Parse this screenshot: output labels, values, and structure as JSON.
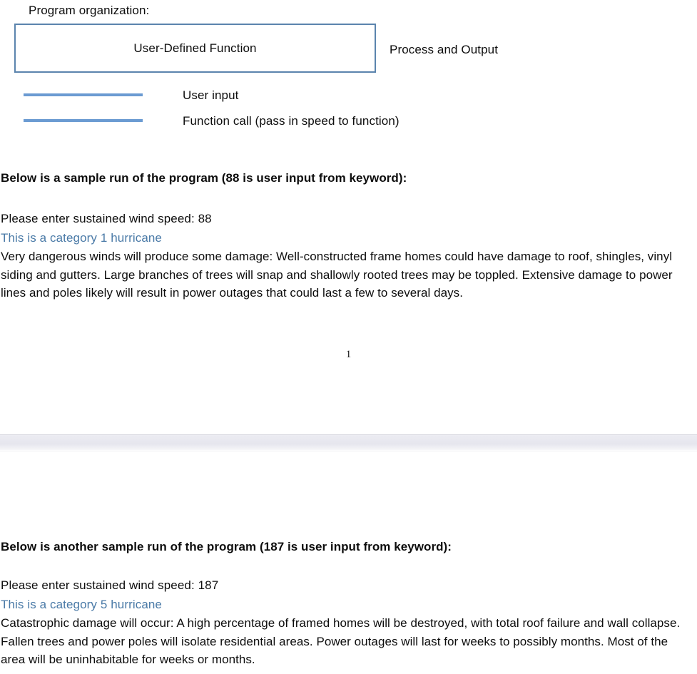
{
  "document": {
    "page_number": "1"
  },
  "diagram": {
    "caption": "Program organization:",
    "function_box_label": "User-Defined Function",
    "process_output_label": "Process and Output",
    "box_border_color": "#5b84ad",
    "legend_line_color": "#6b9bd2",
    "legend": [
      {
        "label": "User input"
      },
      {
        "label": "Function call (pass in speed to function)"
      }
    ]
  },
  "sample_runs": [
    {
      "heading": "Below is a sample run of the program (88 is user input from keyword):",
      "prompt_line": "Please enter sustained wind speed: 88",
      "category_line": "This is a category 1 hurricane",
      "category_color": "#4a7aa7",
      "description": "Very dangerous winds will produce some damage: Well-constructed frame homes could have damage to roof, shingles, vinyl siding and gutters. Large branches of trees will snap and shallowly rooted trees may be toppled. Extensive damage to power lines and poles likely will result in power outages that could last a few to several days."
    },
    {
      "heading": "Below is another sample run of the program (187 is user input from keyword):",
      "prompt_line": "Please enter sustained wind speed: 187",
      "category_line": "This is a category 5 hurricane",
      "category_color": "#4a7aa7",
      "description": "Catastrophic damage will occur: A high percentage of framed homes will be destroyed, with total roof failure and wall collapse. Fallen trees and power poles will isolate residential areas. Power outages will last for weeks to possibly months. Most of the area will be uninhabitable for weeks or months."
    }
  ]
}
